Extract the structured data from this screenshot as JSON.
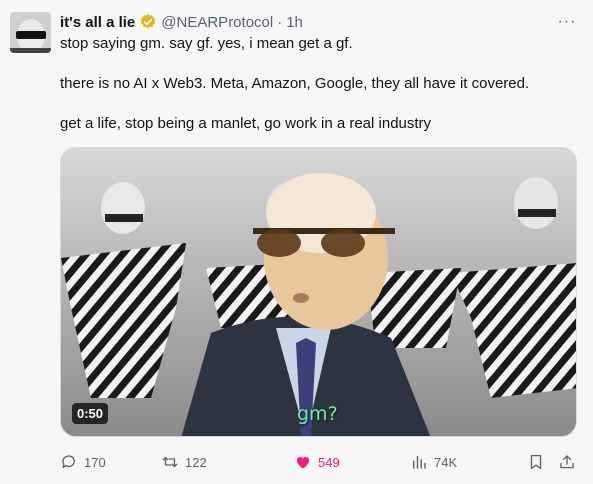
{
  "author": {
    "display_name": "it's all a lie",
    "handle": "@NEARProtocol",
    "separator": "·",
    "time": "1h"
  },
  "tweet": {
    "lines": [
      "stop saying gm. say gf. yes, i mean get a gf.",
      "there is no AI x Web3. Meta, Amazon, Google, they all have it covered.",
      "get a life, stop being a manlet, go work in a real industry"
    ]
  },
  "media": {
    "type": "video",
    "duration": "0:50",
    "caption": "gm?"
  },
  "actions": {
    "replies": "170",
    "reposts": "122",
    "likes": "549",
    "views": "74K"
  },
  "icons": {
    "verified": "verified-badge-icon",
    "more": "more-icon",
    "reply": "reply-icon",
    "repost": "repost-icon",
    "like": "heart-icon",
    "views": "views-icon",
    "bookmark": "bookmark-icon",
    "share": "share-icon"
  },
  "colors": {
    "verified_gold": "#e2b719",
    "like_pink": "#f91880",
    "caption_green": "#6cf09a",
    "secondary_text": "#536471"
  }
}
